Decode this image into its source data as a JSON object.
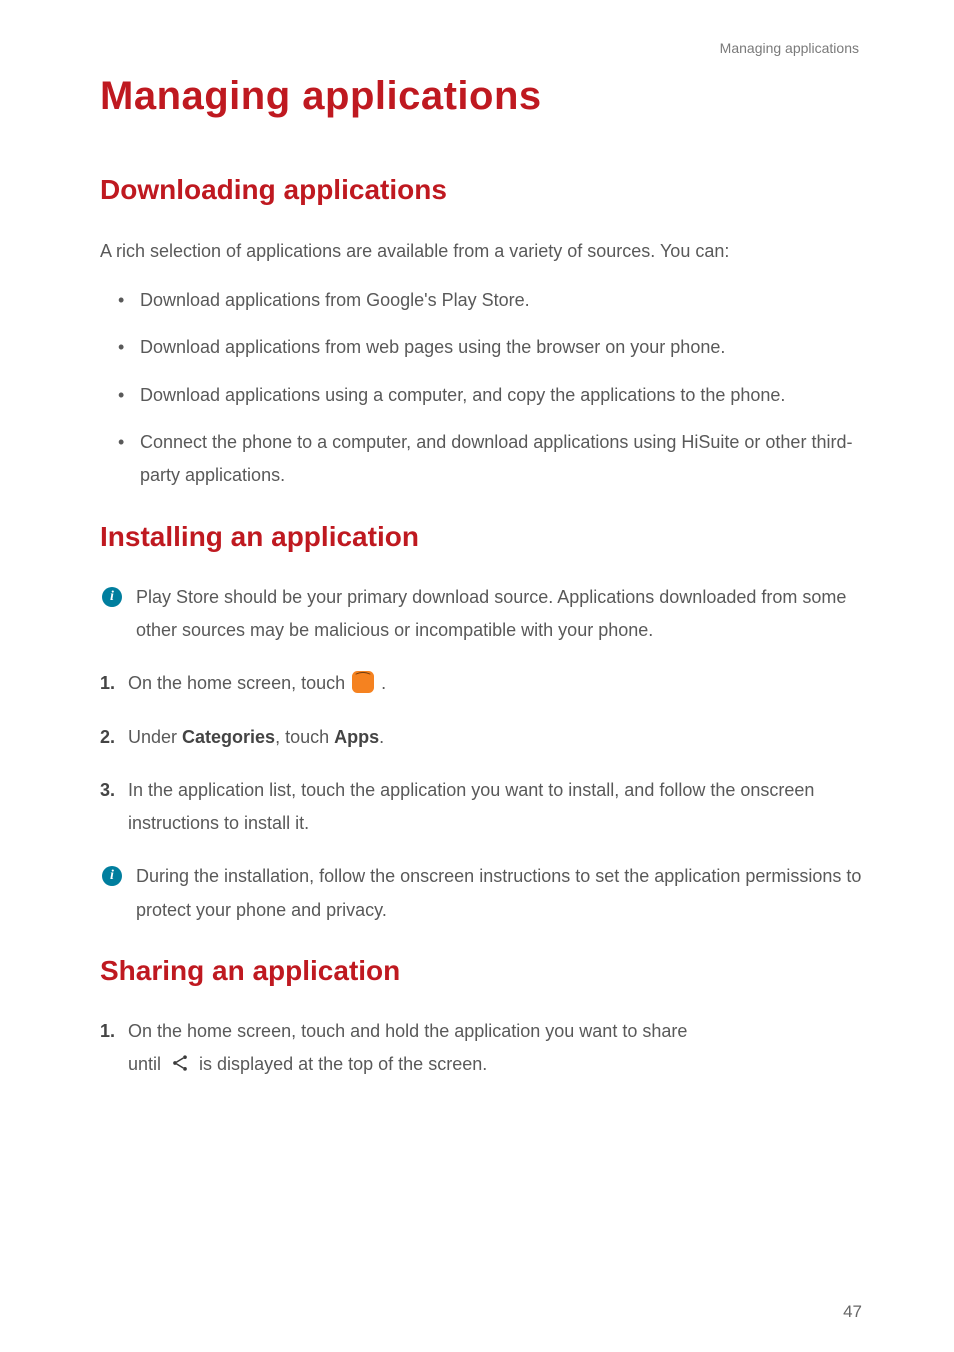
{
  "runningHeader": "Managing applications",
  "title": "Managing applications",
  "sections": {
    "downloading": {
      "heading": "Downloading applications",
      "intro": "A rich selection of applications are available from a variety of sources. You can:",
      "bullets": [
        "Download applications from Google's Play Store.",
        "Download applications from web pages using the browser on your phone.",
        "Download applications using a computer, and copy the applications to the phone.",
        "Connect the phone to a computer, and download applications using HiSuite or other third-party applications."
      ]
    },
    "installing": {
      "heading": "Installing an application",
      "info1": "Play Store should be your primary download source. Applications downloaded from some other sources may be malicious or incompatible with your phone.",
      "step1_prefix": "On the home screen, touch ",
      "step1_suffix": ".",
      "step2_prefix": "Under ",
      "step2_bold1": "Categories",
      "step2_mid": ", touch ",
      "step2_bold2": "Apps",
      "step2_suffix": ".",
      "step3": "In the application list, touch the application you want to install, and follow the onscreen instructions to install it.",
      "info2": "During the installation, follow the onscreen instructions to set the application permissions to protect your phone and privacy."
    },
    "sharing": {
      "heading": "Sharing an application",
      "step1_line1": "On the home screen, touch and hold the application you want to share",
      "step1_line2_prefix": "until ",
      "step1_line2_suffix": " is displayed at the top of the screen."
    }
  },
  "pageNumber": "47"
}
